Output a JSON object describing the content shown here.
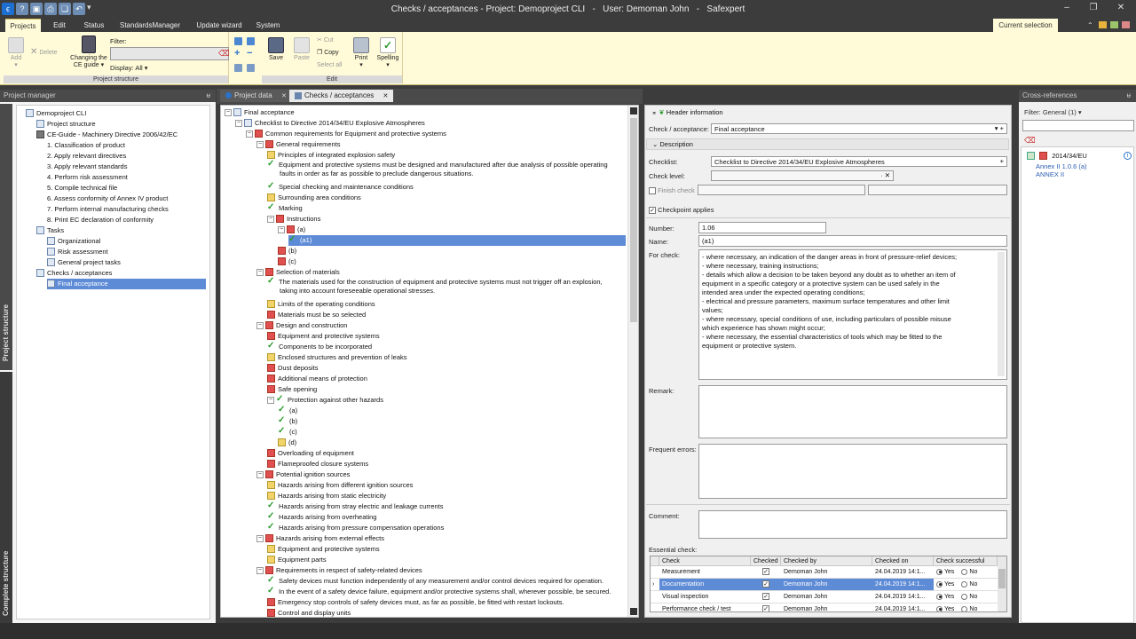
{
  "window": {
    "title": "Checks / acceptances - Project: Demoproject CLI   -   User: Demoman John   -   Safexpert",
    "qat_icons": [
      "help-icon",
      "save-icon",
      "print-icon",
      "copy-icon",
      "undo-icon"
    ],
    "qat_dropdown": "▾",
    "controls": [
      "–",
      "❐",
      "✕"
    ]
  },
  "menu": {
    "tabs": [
      "Projects",
      "Edit",
      "Status",
      "StandardsManager",
      "Update wizard",
      "System"
    ],
    "active": "Projects",
    "current_selection": "Current selection"
  },
  "ribbon": {
    "add": "Add",
    "delete": "Delete",
    "changing_ce_guide_1": "Changing the",
    "changing_ce_guide_2": "CE guide ▾",
    "filter_label": "Filter:",
    "display_label": "Display: All ▾",
    "group_project_structure": "Project structure",
    "save": "Save",
    "paste": "Paste",
    "cut": "Cut",
    "copy": "Copy",
    "select_all": "Select all",
    "print": "Print",
    "spelling": "Spelling",
    "group_edit": "Edit"
  },
  "project_manager": {
    "title": "Project manager",
    "pin": "ᵾ",
    "vtab_project": "Project structure",
    "vtab_complete": "Complete structure",
    "tree": [
      {
        "label": "Demoproject CLI",
        "indent": 0,
        "icon": "i-doc"
      },
      {
        "label": "Project structure",
        "indent": 1,
        "icon": "i-doc"
      },
      {
        "label": "CE-Guide - Machinery Directive 2006/42/EC",
        "indent": 1,
        "icon": "i-blk"
      },
      {
        "label": "1. Classification of product",
        "indent": 2,
        "icon": ""
      },
      {
        "label": "2. Apply relevant directives",
        "indent": 2,
        "icon": ""
      },
      {
        "label": "3. Apply relevant standards",
        "indent": 2,
        "icon": ""
      },
      {
        "label": "4. Perform risk assessment",
        "indent": 2,
        "icon": ""
      },
      {
        "label": "5. Compile technical file",
        "indent": 2,
        "icon": ""
      },
      {
        "label": "6. Assess conformity of Annex IV product",
        "indent": 2,
        "icon": ""
      },
      {
        "label": "7. Perform internal manufacturing checks",
        "indent": 2,
        "icon": ""
      },
      {
        "label": "8. Print EC declaration of conformity",
        "indent": 2,
        "icon": ""
      },
      {
        "label": "Tasks",
        "indent": 1,
        "icon": "i-doc"
      },
      {
        "label": "Organizational",
        "indent": 2,
        "icon": "i-doc"
      },
      {
        "label": "Risk assessment",
        "indent": 2,
        "icon": "i-doc"
      },
      {
        "label": "General project tasks",
        "indent": 2,
        "icon": "i-doc"
      },
      {
        "label": "Checks / acceptances",
        "indent": 1,
        "icon": "i-doc"
      },
      {
        "label": "Final acceptance",
        "indent": 2,
        "icon": "i-doc",
        "selected": true
      }
    ]
  },
  "tabs": [
    {
      "label": "Project data",
      "close": "✕"
    },
    {
      "label": "Checks / acceptances",
      "close": "✕"
    }
  ],
  "checks_tree": [
    {
      "label": "Final acceptance",
      "indent": 0,
      "icon": "i-doc",
      "exp": "−"
    },
    {
      "label": "Checklist to Directive 2014/34/EU Explosive Atmospheres",
      "indent": 1,
      "icon": "i-doc",
      "exp": "−"
    },
    {
      "label": "Common requirements for Equipment and protective systems",
      "indent": 2,
      "icon": "i-red",
      "exp": "−"
    },
    {
      "label": "General requirements",
      "indent": 3,
      "icon": "i-red",
      "exp": "−"
    },
    {
      "label": "Principles of integrated explosion safety",
      "indent": 4,
      "icon": "i-yel"
    },
    {
      "label": "Equipment and protective systems must be designed and manufactured after due analysis of possible operating",
      "label2": "faults in order as far as possible to preclude dangerous situations.",
      "indent": 4,
      "icon": "i-chk",
      "two": true
    },
    {
      "label": "Special checking and maintenance conditions",
      "indent": 4,
      "icon": "i-chk"
    },
    {
      "label": "Surrounding area conditions",
      "indent": 4,
      "icon": "i-yel"
    },
    {
      "label": "Marking",
      "indent": 4,
      "icon": "i-chk"
    },
    {
      "label": "Instructions",
      "indent": 4,
      "icon": "i-red",
      "exp": "−"
    },
    {
      "label": "(a)",
      "indent": 5,
      "icon": "i-red",
      "exp": "−"
    },
    {
      "label": "(a1)",
      "indent": 6,
      "icon": "i-chk",
      "selected": true
    },
    {
      "label": "(b)",
      "indent": 5,
      "icon": "i-red"
    },
    {
      "label": "(c)",
      "indent": 5,
      "icon": "i-red"
    },
    {
      "label": "Selection of materials",
      "indent": 3,
      "icon": "i-red",
      "exp": "−"
    },
    {
      "label": "The materials used for the construction of equipment and protective systems must not trigger off an explosion,",
      "label2": "taking into account foreseeable operational stresses.",
      "indent": 4,
      "icon": "i-chk",
      "two": true
    },
    {
      "label": "Limits of the operating conditions",
      "indent": 4,
      "icon": "i-yel"
    },
    {
      "label": "Materials must be so selected",
      "indent": 4,
      "icon": "i-red"
    },
    {
      "label": "Design and construction",
      "indent": 3,
      "icon": "i-red",
      "exp": "−"
    },
    {
      "label": "Equipment and protective systems",
      "indent": 4,
      "icon": "i-red"
    },
    {
      "label": "Components to be incorporated",
      "indent": 4,
      "icon": "i-chk"
    },
    {
      "label": "Enclosed structures and prevention of leaks",
      "indent": 4,
      "icon": "i-yel"
    },
    {
      "label": "Dust deposits",
      "indent": 4,
      "icon": "i-red"
    },
    {
      "label": "Additional means of protection",
      "indent": 4,
      "icon": "i-red"
    },
    {
      "label": "Safe opening",
      "indent": 4,
      "icon": "i-red"
    },
    {
      "label": "Protection against other hazards",
      "indent": 4,
      "icon": "i-chk",
      "exp": "−"
    },
    {
      "label": "(a)",
      "indent": 5,
      "icon": "i-chk"
    },
    {
      "label": "(b)",
      "indent": 5,
      "icon": "i-chk"
    },
    {
      "label": "(c)",
      "indent": 5,
      "icon": "i-chk"
    },
    {
      "label": "(d)",
      "indent": 5,
      "icon": "i-yel"
    },
    {
      "label": "Overloading of equipment",
      "indent": 4,
      "icon": "i-red"
    },
    {
      "label": "Flameproofed closure systems",
      "indent": 4,
      "icon": "i-red"
    },
    {
      "label": "Potential ignition sources",
      "indent": 3,
      "icon": "i-red",
      "exp": "−"
    },
    {
      "label": "Hazards arising from different ignition sources",
      "indent": 4,
      "icon": "i-yel"
    },
    {
      "label": "Hazards arising from static electricity",
      "indent": 4,
      "icon": "i-yel"
    },
    {
      "label": "Hazards arising from stray electric and leakage currents",
      "indent": 4,
      "icon": "i-chk"
    },
    {
      "label": "Hazards arising from overheating",
      "indent": 4,
      "icon": "i-chk"
    },
    {
      "label": "Hazards arising from pressure compensation operations",
      "indent": 4,
      "icon": "i-chk"
    },
    {
      "label": "Hazards arising from external effects",
      "indent": 3,
      "icon": "i-red",
      "exp": "−"
    },
    {
      "label": "Equipment and protective systems",
      "indent": 4,
      "icon": "i-yel"
    },
    {
      "label": "Equipment parts",
      "indent": 4,
      "icon": "i-yel"
    },
    {
      "label": "Requirements in respect of safety-related devices",
      "indent": 3,
      "icon": "i-red",
      "exp": "−"
    },
    {
      "label": "Safety devices must function independently of any measurement and/or control devices required for operation.",
      "indent": 4,
      "icon": "i-chk"
    },
    {
      "label": "In the event of a safety device failure, equipment and/or protective systems shall, wherever possible, be secured.",
      "indent": 4,
      "icon": "i-chk"
    },
    {
      "label": "Emergency stop controls of safety devices must, as far as possible, be fitted with restart lockouts.",
      "indent": 4,
      "icon": "i-red"
    },
    {
      "label": "Control and display units",
      "indent": 4,
      "icon": "i-red"
    },
    {
      "label": "Requirements in respect of devices with a measuring function for explosion protection",
      "indent": 4,
      "icon": "i-red"
    }
  ],
  "detail": {
    "header_info": "Header information",
    "check_acceptance_label": "Check / acceptance:",
    "check_acceptance_value": "Final acceptance",
    "description": "Description",
    "checklist_label": "Checklist:",
    "checklist_value": "Checklist to Directive 2014/34/EU Explosive Atmospheres",
    "check_level_label": "Check level:",
    "check_level_value": "",
    "finish_check_label": "Finish check",
    "checkpoint_applies": "Checkpoint applies",
    "number_label": "Number:",
    "number_value": "1.06",
    "name_label": "Name:",
    "name_value": "(a1)",
    "for_check_label": "For check:",
    "for_check_lines": [
      "- where necessary, an indication of the danger areas in front of pressure-relief devices;",
      "- where necessary, training instructions;",
      "- details which allow a decision to be taken beyond any doubt as to whether an item of",
      "equipment in a specific category or a protective system can be used safely in the",
      "intended area under the expected operating conditions;",
      "- electrical and pressure parameters, maximum surface temperatures and other limit",
      "values;",
      "- where necessary, special conditions of use, including particulars of possible misuse",
      "which experience has shown might occur;",
      "- where necessary, the essential characteristics of tools which may be fitted to the",
      "equipment or protective system."
    ],
    "remark_label": "Remark:",
    "frequent_errors_label": "Frequent errors:",
    "comment_label": "Comment:",
    "essential_check_label": "Essential check:",
    "grid_headers": [
      "Check",
      "Checked",
      "Checked by",
      "Checked on",
      "Check successful"
    ],
    "grid_rows": [
      {
        "check": "Measurement",
        "checked": "✓",
        "by": "Demoman John",
        "on": "24.04.2019 14:1...",
        "yes": "Yes",
        "no": "No"
      },
      {
        "check": "Documentation",
        "checked": "✓",
        "by": "Demoman John",
        "on": "24.04.2019 14:1...",
        "yes": "Yes",
        "no": "No",
        "selected": true
      },
      {
        "check": "Visual inspection",
        "checked": "✓",
        "by": "Demoman John",
        "on": "24.04.2019 14:1...",
        "yes": "Yes",
        "no": "No"
      },
      {
        "check": "Performance check / test",
        "checked": "✓",
        "by": "Demoman John",
        "on": "24.04.2019 14:1...",
        "yes": "Yes",
        "no": "No"
      }
    ],
    "row_pointer": "›"
  },
  "cross_refs": {
    "title": "Cross-references",
    "filter": "Filter: General (1) ▾",
    "item": "2014/34/EU",
    "ref1": "Annex II 1.0.6 (a)",
    "ref2": "ANNEX II"
  },
  "colors": {
    "accent": "#5e8bd6",
    "ribbon": "#fffbd8",
    "dark": "#3c3c3c"
  }
}
